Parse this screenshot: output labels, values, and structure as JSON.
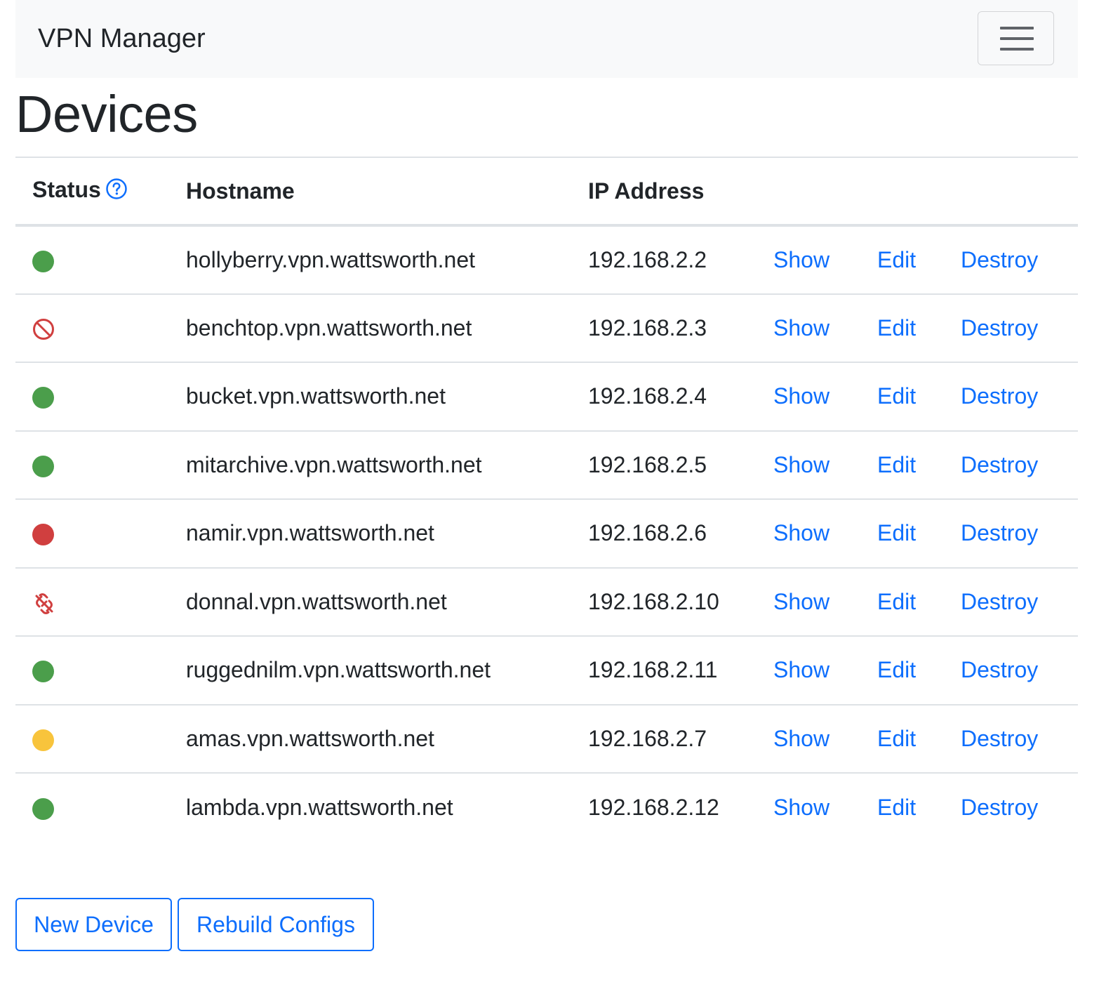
{
  "navbar": {
    "brand": "VPN Manager",
    "toggler_icon": "hamburger-menu-icon"
  },
  "page": {
    "title": "Devices"
  },
  "table": {
    "headers": {
      "status": "Status",
      "hostname": "Hostname",
      "ip": "IP Address"
    },
    "help_icon": "question-circle-icon",
    "action_labels": {
      "show": "Show",
      "edit": "Edit",
      "destroy": "Destroy"
    },
    "rows": [
      {
        "status": "online",
        "hostname": "hollyberry.vpn.wattsworth.net",
        "ip": "192.168.2.2"
      },
      {
        "status": "disabled",
        "hostname": "benchtop.vpn.wattsworth.net",
        "ip": "192.168.2.3"
      },
      {
        "status": "online",
        "hostname": "bucket.vpn.wattsworth.net",
        "ip": "192.168.2.4"
      },
      {
        "status": "online",
        "hostname": "mitarchive.vpn.wattsworth.net",
        "ip": "192.168.2.5"
      },
      {
        "status": "offline",
        "hostname": "namir.vpn.wattsworth.net",
        "ip": "192.168.2.6"
      },
      {
        "status": "unlinked",
        "hostname": "donnal.vpn.wattsworth.net",
        "ip": "192.168.2.10"
      },
      {
        "status": "online",
        "hostname": "ruggednilm.vpn.wattsworth.net",
        "ip": "192.168.2.11"
      },
      {
        "status": "warning",
        "hostname": "amas.vpn.wattsworth.net",
        "ip": "192.168.2.7"
      },
      {
        "status": "online",
        "hostname": "lambda.vpn.wattsworth.net",
        "ip": "192.168.2.12"
      }
    ]
  },
  "actions": {
    "new_device": "New Device",
    "rebuild_configs": "Rebuild Configs"
  },
  "colors": {
    "link": "#0d6efd",
    "online": "#4b9e4b",
    "offline": "#d03f3f",
    "warning": "#f8c43c",
    "disabled": "#d03f3f",
    "navbar_bg": "#f8f9fa",
    "border": "#dee2e6"
  }
}
